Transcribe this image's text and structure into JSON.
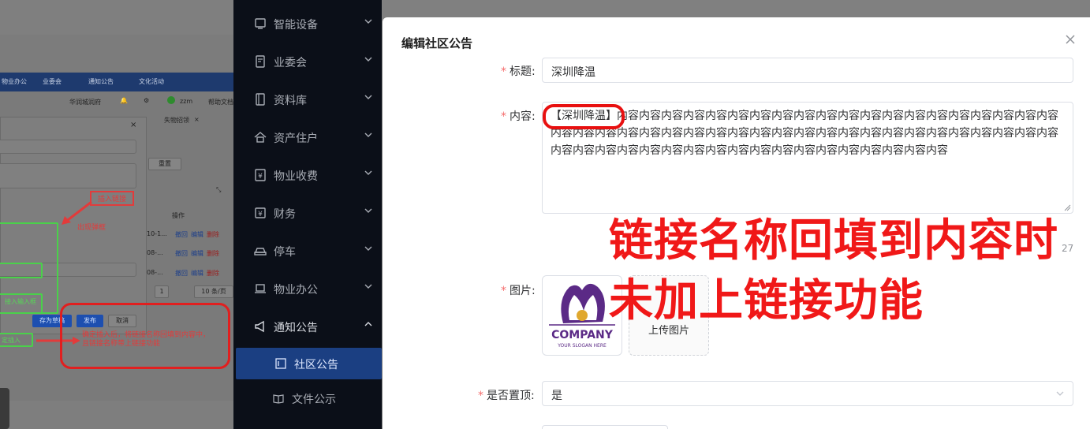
{
  "embedded_screenshot": {
    "tabs": [
      "物业办公",
      "业委会",
      "通知公告",
      "文化活动"
    ],
    "org_name": "华润城润府",
    "user_name": "zzm",
    "help_label": "帮助文档",
    "lost_found_tab": "失物招领",
    "reset_label": "重置",
    "ops_header": "操作",
    "row_actions": [
      "撤回",
      "编辑",
      "删除"
    ],
    "date_snippets": [
      "10-1...",
      "08-...",
      "08-..."
    ],
    "pager": {
      "page": "1",
      "page_size": "10 条/页"
    },
    "dialog_buttons": {
      "draft": "存为草稿",
      "publish": "发布",
      "cancel": "取消"
    },
    "annotations": {
      "insert_link": "插入链接",
      "popup_appears": "出现弹框",
      "input_box": "接入输入框",
      "confirm_insert": "定插入",
      "confirm_note_line1": "确定插入后，将链接名称回填到内容中，",
      "confirm_note_line2": "且链接名称带上链接功能"
    }
  },
  "sidebar": {
    "items": [
      {
        "label": "智能设备",
        "icon": "monitor-icon"
      },
      {
        "label": "业委会",
        "icon": "document-check-icon"
      },
      {
        "label": "资料库",
        "icon": "book-icon"
      },
      {
        "label": "资产住户",
        "icon": "home-icon"
      },
      {
        "label": "物业收费",
        "icon": "yen-receipt-icon"
      },
      {
        "label": "财务",
        "icon": "yen-box-icon"
      },
      {
        "label": "停车",
        "icon": "car-icon"
      },
      {
        "label": "物业办公",
        "icon": "laptop-icon"
      },
      {
        "label": "通知公告",
        "icon": "megaphone-icon",
        "expanded": true
      }
    ],
    "subitems": [
      {
        "label": "社区公告",
        "icon": "board-icon",
        "active": true
      },
      {
        "label": "文件公示",
        "icon": "open-book-icon"
      }
    ]
  },
  "dialog": {
    "title": "编辑社区公告",
    "fields": {
      "title_label": "标题:",
      "title_value": "深圳降温",
      "content_label": "内容:",
      "content_value": "【深圳降温】内容内容内容内容内容内容内容内容内容内容内容内容内容内容内容内容内容内容内容内容内容内容内容内容内容内容内容内容内容内容内容内容内容内容内容内容内容内容内容内容内容内容内容内容内容内容内容内容内容内容内容内容内容内容内容内容内容内容内容内容内容",
      "char_count": "27",
      "image_label": "图片:",
      "upload_label": "上传图片",
      "pin_label": "是否置顶:",
      "pin_value": "是"
    },
    "thumbnail": {
      "brand": "COMPANY",
      "slogan": "YOUR SLOGAN HERE",
      "colors": {
        "purple": "#5b2a86",
        "gold": "#e0a82e"
      }
    }
  },
  "annotation": {
    "line1": "链接名称回填到内容时",
    "line2": "未加上链接功能",
    "color": "#f01818"
  },
  "colors": {
    "sidebar_bg": "#0b0f18",
    "active_item": "#1b3f82",
    "required": "#f56c6c"
  }
}
